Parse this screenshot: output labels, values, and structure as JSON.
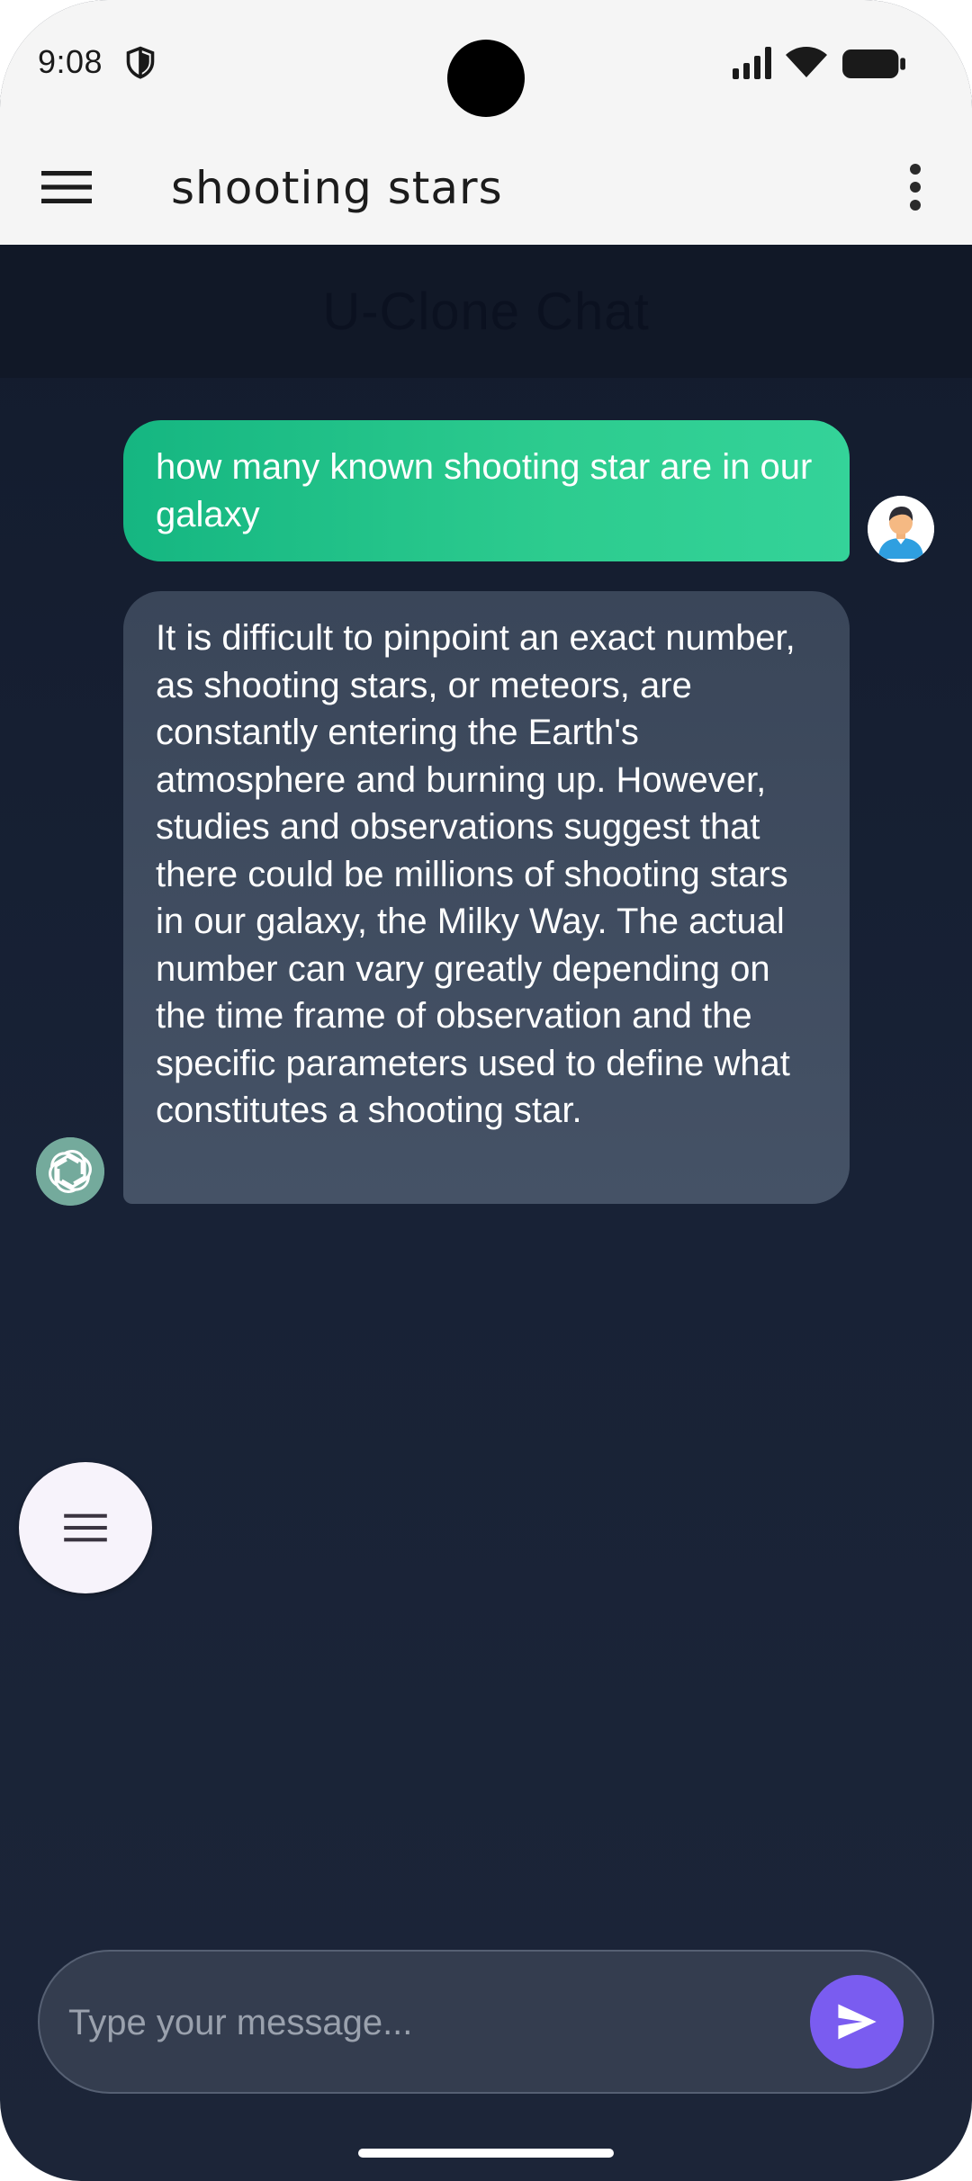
{
  "status_bar": {
    "time": "9:08"
  },
  "app_bar": {
    "title": "shooting stars"
  },
  "page_header": {
    "title": "U-Clone Chat"
  },
  "messages": [
    {
      "role": "user",
      "text": "how many known shooting star are in our galaxy"
    },
    {
      "role": "assistant",
      "text": "It is difficult to pinpoint an exact number, as shooting stars, or meteors, are constantly entering the Earth's atmosphere and burning up. However, studies and observations suggest that there could be millions of shooting stars in our galaxy, the Milky Way. The actual number can vary greatly depending on the time frame of observation and the specific parameters used to define what constitutes a shooting star."
    }
  ],
  "composer": {
    "placeholder": "Type your message..."
  },
  "icons": {
    "menu": "hamburger-menu-icon",
    "more": "more-vertical-icon",
    "send": "send-icon",
    "fab": "hamburger-menu-icon",
    "bot_avatar": "openai-logo-icon",
    "user_avatar": "user-avatar-icon"
  },
  "colors": {
    "user_bubble": "#2dcc8f",
    "bot_bubble": "#404c60",
    "send_button": "#7a5cf0",
    "background": "#182236"
  }
}
